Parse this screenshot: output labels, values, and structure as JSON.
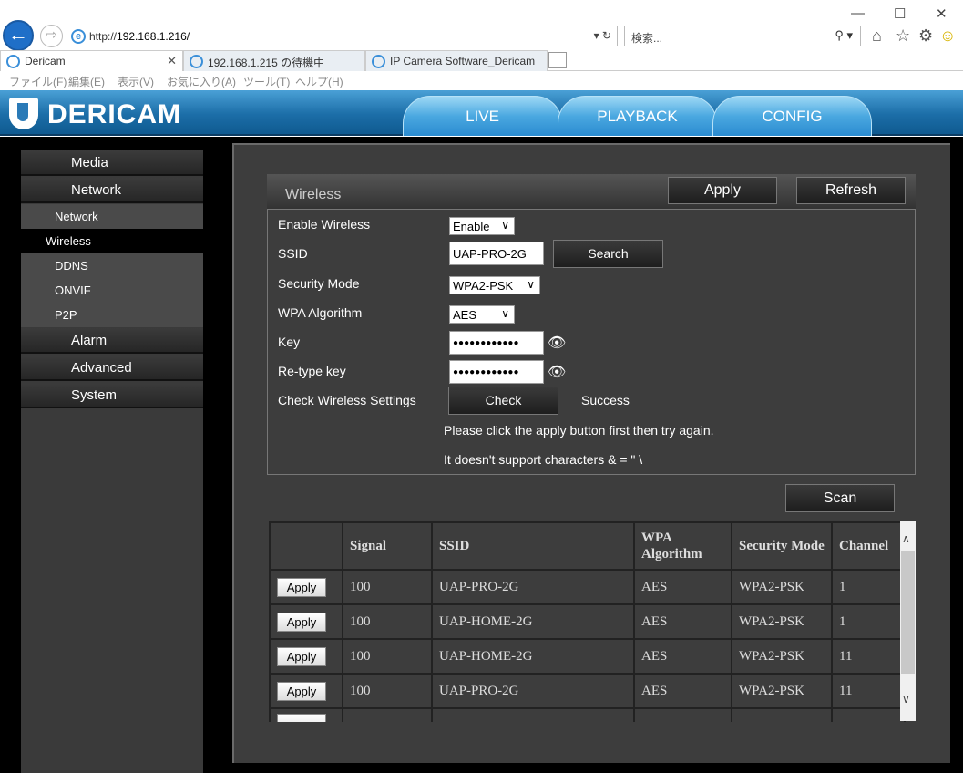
{
  "browser": {
    "url_prefix": "http://",
    "url_host": "192.168.1.216/",
    "search_placeholder": "検索...",
    "tabs": [
      {
        "label": "Dericam"
      },
      {
        "label": "192.168.1.215 の待機中"
      },
      {
        "label": "IP Camera Software_Dericam"
      }
    ],
    "menu": [
      "ファイル(F)",
      "編集(E)",
      "表示(V)",
      "お気に入り(A)",
      "ツール(T)",
      "ヘルプ(H)"
    ]
  },
  "app": {
    "logo": "DERICAM",
    "nav_tabs": [
      "LIVE",
      "PLAYBACK",
      "CONFIG"
    ]
  },
  "sidebar": {
    "main1": "Media",
    "main2": "Network",
    "subs": [
      "Network",
      "Wireless",
      "DDNS",
      "ONVIF",
      "P2P"
    ],
    "main3": "Alarm",
    "main4": "Advanced",
    "main5": "System"
  },
  "panel": {
    "title": "Wireless",
    "apply": "Apply",
    "refresh": "Refresh"
  },
  "form": {
    "enable_label": "Enable Wireless",
    "enable_value": "Enable",
    "ssid_label": "SSID",
    "ssid_value": "UAP-PRO-2G",
    "search_btn": "Search",
    "security_label": "Security Mode",
    "security_value": "WPA2-PSK",
    "algo_label": "WPA Algorithm",
    "algo_value": "AES",
    "key_label": "Key",
    "key_value": "●●●●●●●●●●●●",
    "retype_label": "Re-type key",
    "retype_value": "●●●●●●●●●●●●",
    "check_label": "Check Wireless Settings",
    "check_btn": "Check",
    "check_status": "Success",
    "note1": "Please click the apply button first then try again.",
    "note2": "It doesn't support characters & = \" \\"
  },
  "scan": {
    "button": "Scan",
    "headers": [
      "Signal",
      "SSID",
      "WPA Algorithm",
      "Security Mode",
      "Channel"
    ],
    "rows": [
      {
        "apply": "Apply",
        "signal": "100",
        "ssid": "UAP-PRO-2G",
        "algo": "AES",
        "mode": "WPA2-PSK",
        "channel": "1"
      },
      {
        "apply": "Apply",
        "signal": "100",
        "ssid": "UAP-HOME-2G",
        "algo": "AES",
        "mode": "WPA2-PSK",
        "channel": "1"
      },
      {
        "apply": "Apply",
        "signal": "100",
        "ssid": "UAP-HOME-2G",
        "algo": "AES",
        "mode": "WPA2-PSK",
        "channel": "11"
      },
      {
        "apply": "Apply",
        "signal": "100",
        "ssid": "UAP-PRO-2G",
        "algo": "AES",
        "mode": "WPA2-PSK",
        "channel": "11"
      }
    ]
  }
}
